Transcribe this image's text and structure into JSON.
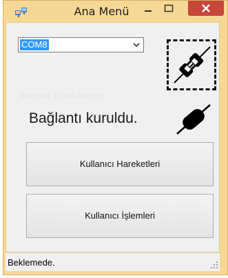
{
  "window": {
    "title": "Ana Menü",
    "icons": {
      "app": "app-window-icon",
      "minimize": "minimize-icon",
      "maximize": "maximize-icon",
      "close": "close-icon"
    },
    "colors": {
      "frame": "#f6d896",
      "close": "#c7473b"
    }
  },
  "port_select": {
    "value": "COM8",
    "icon": "chevron-down-icon"
  },
  "connect_button": {
    "icon": "plug-connect-icon"
  },
  "faint_label": "Pencere Ekran Alıntısı",
  "connection": {
    "status_text": "Bağlantı kuruldu.",
    "icon": "plug-connected-icon"
  },
  "buttons": {
    "user_actions": "Kullanıcı Hareketleri",
    "user_operations": "Kullanıcı İşlemleri"
  },
  "statusbar": {
    "text": "Beklemede.",
    "grip_icon": "resize-grip-icon"
  }
}
